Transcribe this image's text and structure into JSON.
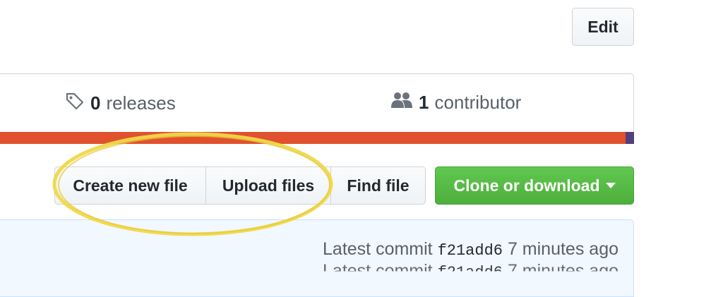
{
  "header": {
    "edit_label": "Edit"
  },
  "summary": {
    "releases_count": "0",
    "releases_label": "releases",
    "contributors_count": "1",
    "contributors_label": "contributor"
  },
  "language_bar": {
    "primary_color": "#e0522d",
    "secondary_color": "#563d7c"
  },
  "file_actions": {
    "create_label": "Create new file",
    "upload_label": "Upload files",
    "find_label": "Find file",
    "clone_label": "Clone or download"
  },
  "commit": {
    "prefix": "Latest commit",
    "sha": "f21add6",
    "time": "7 minutes ago"
  },
  "annotation": {
    "color": "#f0d84a"
  }
}
